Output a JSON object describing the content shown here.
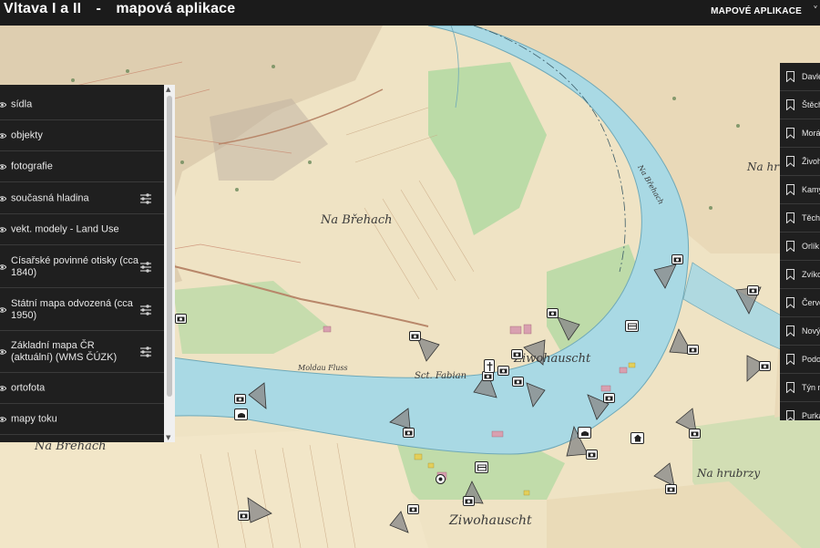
{
  "header": {
    "app_title": "Vltava I a II",
    "separator": "-",
    "app_subtitle": "mapová aplikace",
    "nav_link": "MAPOVÉ APLIKACE",
    "nav_chevron": "˅"
  },
  "layers": [
    {
      "label": "sídla",
      "has_settings": false
    },
    {
      "label": "objekty",
      "has_settings": false
    },
    {
      "label": "fotografie",
      "has_settings": false
    },
    {
      "label": "současná hladina",
      "has_settings": true
    },
    {
      "label": "vekt. modely - Land Use",
      "has_settings": false
    },
    {
      "label": "Císařské povinné otisky (cca 1840)",
      "has_settings": true
    },
    {
      "label": "Státní mapa odvozená (cca 1950)",
      "has_settings": true
    },
    {
      "label": "Základní mapa ČR (aktuální) (WMS ČÚZK)",
      "has_settings": true
    },
    {
      "label": "ortofota",
      "has_settings": false
    },
    {
      "label": "mapy toku",
      "has_settings": false
    }
  ],
  "bookmarks": [
    "Davle",
    "Štěchovice",
    "Moráň",
    "Živohošť",
    "Kamýk",
    "Těchnice",
    "Orlík",
    "Zvíkov",
    "Červená",
    "Nový",
    "Podolí",
    "Týn nad",
    "Purkarec"
  ],
  "map_labels": {
    "na_brehach_top": "Na Břehach",
    "na_brehach_left": "Na Břehach",
    "sct_fabian": "Sct. Fabian",
    "ziwohauscht_mid": "Ziwohauscht",
    "ziwohauscht_bottom": "Ziwohauscht",
    "na_hrubrzy_top": "Na hrubrzy",
    "na_hrubrzy_bottom": "Na hrubrzy",
    "moldau_fluss": "Moldau Fluss",
    "na_brehach_right": "Na Břehach"
  },
  "icons": {
    "layer_visibility": "eye-icon",
    "layer_settings": "sliders-icon",
    "bookmark": "bookmark-icon",
    "photo_marker": "camera-icon",
    "object_marker": "building-icon",
    "house_marker": "house-icon",
    "church_marker": "cross-icon",
    "settlement_marker": "dot-icon"
  },
  "colors": {
    "header_bg": "#1b1b1b",
    "panel_bg": "#1f1f1f",
    "river": "#a9d9e4",
    "land": "#efe3c4",
    "meadow": "#b5d9a4",
    "view_cone": "#8b8b8b"
  }
}
